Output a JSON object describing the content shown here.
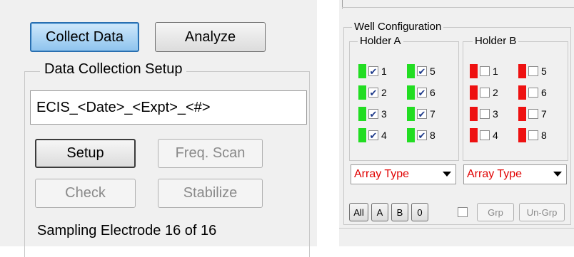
{
  "left": {
    "buttons": {
      "collect_data": "Collect Data",
      "analyze": "Analyze",
      "setup": "Setup",
      "freq_scan": "Freq. Scan",
      "check": "Check",
      "stabilize": "Stabilize"
    },
    "group_title": "Data Collection Setup",
    "filename_value": "ECIS_<Date>_<Expt>_<#>",
    "status": "Sampling Electrode 16 of 16"
  },
  "right": {
    "well_config_title": "Well Configuration",
    "holder_a": {
      "title": "Holder A",
      "indicator_color": "#22dd22",
      "wells": [
        {
          "num": "1",
          "checked": true
        },
        {
          "num": "2",
          "checked": true
        },
        {
          "num": "3",
          "checked": true
        },
        {
          "num": "4",
          "checked": true
        },
        {
          "num": "5",
          "checked": true
        },
        {
          "num": "6",
          "checked": true
        },
        {
          "num": "7",
          "checked": true
        },
        {
          "num": "8",
          "checked": true
        }
      ],
      "array_type": "Array Type"
    },
    "holder_b": {
      "title": "Holder B",
      "indicator_color": "#ee1111",
      "wells": [
        {
          "num": "1",
          "checked": false
        },
        {
          "num": "2",
          "checked": false
        },
        {
          "num": "3",
          "checked": false
        },
        {
          "num": "4",
          "checked": false
        },
        {
          "num": "5",
          "checked": false
        },
        {
          "num": "6",
          "checked": false
        },
        {
          "num": "7",
          "checked": false
        },
        {
          "num": "8",
          "checked": false
        }
      ],
      "array_type": "Array Type"
    },
    "bottom_buttons": {
      "all": "All",
      "a": "A",
      "b": "B",
      "zero": "0",
      "grp": "Grp",
      "un_grp": "Un-Grp"
    }
  }
}
